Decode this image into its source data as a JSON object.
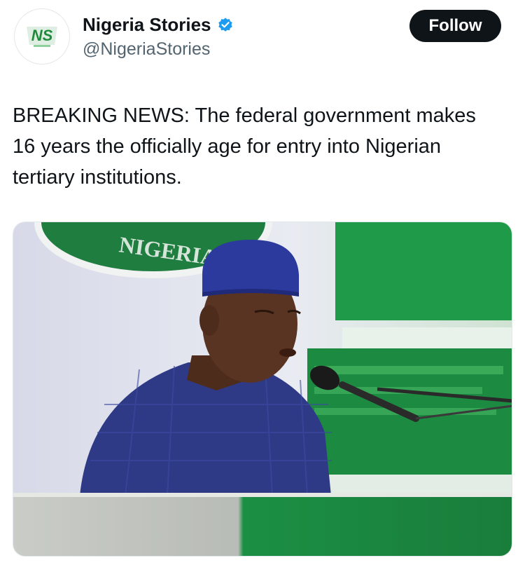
{
  "account": {
    "display_name": "Nigeria Stories",
    "handle": "@NigeriaStories",
    "avatar_text": "NS",
    "verified_icon": "verified-badge-icon"
  },
  "follow_button": {
    "label": "Follow"
  },
  "tweet": {
    "text": "BREAKING NEWS: The federal government makes\n16 years the officially age for  entry into Nigerian\ntertiary institutions."
  },
  "media": {
    "backdrop_text": "NIGERIA",
    "colors": {
      "green": "#1f8a3c",
      "cap": "#2b3a9c",
      "agbada": "#2e3a86",
      "skin": "#5a3422"
    }
  }
}
